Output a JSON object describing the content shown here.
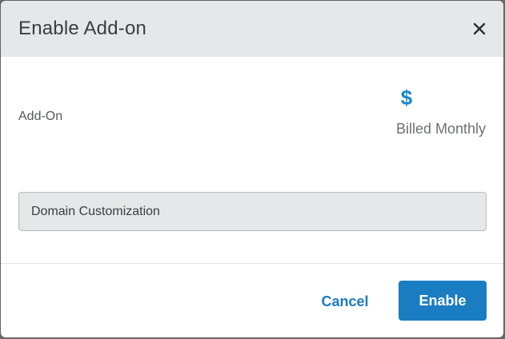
{
  "dialog": {
    "title": "Enable Add-on",
    "close_icon": "close-icon"
  },
  "pricing": {
    "currency_symbol": "$",
    "period": "Billed Monthly",
    "accent_color": "#1a86c8"
  },
  "addon_field": {
    "label": "Add-On",
    "value": "Domain Customization"
  },
  "footer": {
    "cancel_label": "Cancel",
    "enable_label": "Enable",
    "primary_color": "#1a7cc1"
  }
}
